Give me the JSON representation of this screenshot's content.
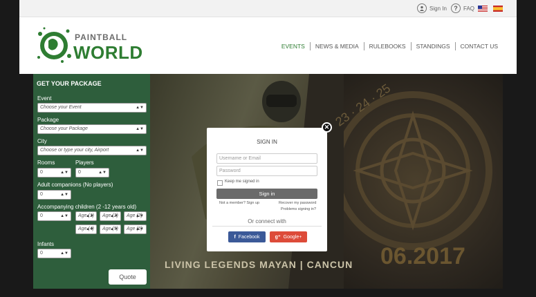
{
  "topbar": {
    "signin": "Sign In",
    "faq": "FAQ",
    "languages": [
      "english-flag",
      "spanish-flag"
    ]
  },
  "logo": {
    "line1": "PAINTBALL",
    "line2": "WORLD"
  },
  "nav": [
    {
      "label": "EVENTS",
      "active": true
    },
    {
      "label": "NEWS & MEDIA"
    },
    {
      "label": "RULEBOOKS"
    },
    {
      "label": "STANDINGS"
    },
    {
      "label": "CONTACT US"
    }
  ],
  "hero": {
    "title": "LIVING LEGENDS MAYAN | CANCUN",
    "date": "06.2017",
    "nums": "23 · 24 · 25"
  },
  "package": {
    "title": "GET YOUR PACKAGE",
    "event_label": "Event",
    "event_value": "Choose your Event",
    "package_label": "Package",
    "package_value": "Choose your Package",
    "city_label": "City",
    "city_value": "Choose or type your city, Airport",
    "rooms_label": "Rooms",
    "rooms_value": "0",
    "players_label": "Players",
    "players_value": "0",
    "adult_label": "Adult companions (No players)",
    "adult_value": "0",
    "children_label": "Accompanying children (2 -12 years old)",
    "children_value": "0",
    "ages": [
      "Age (1)",
      "Age (2)",
      "Age (3)",
      "Age (4)",
      "Age (5)",
      "Age (6)"
    ],
    "infants_label": "Infants",
    "infants_value": "0",
    "quote": "Quote"
  },
  "modal": {
    "title": "SIGN IN",
    "username_placeholder": "Username or Email",
    "password_placeholder": "Password",
    "keep": "Keep me signed in",
    "signin": "Sign in",
    "not_member": "Not a member? Sign up",
    "recover": "Recover my password",
    "problems": "Problems signing in?",
    "or_connect": "Or connect with",
    "facebook": "Facebook",
    "google": "Google+"
  },
  "colors": {
    "brand_green": "#2e7d32",
    "sidebar": "#2e5e3c",
    "facebook": "#3b5998",
    "google": "#dd4b39"
  }
}
